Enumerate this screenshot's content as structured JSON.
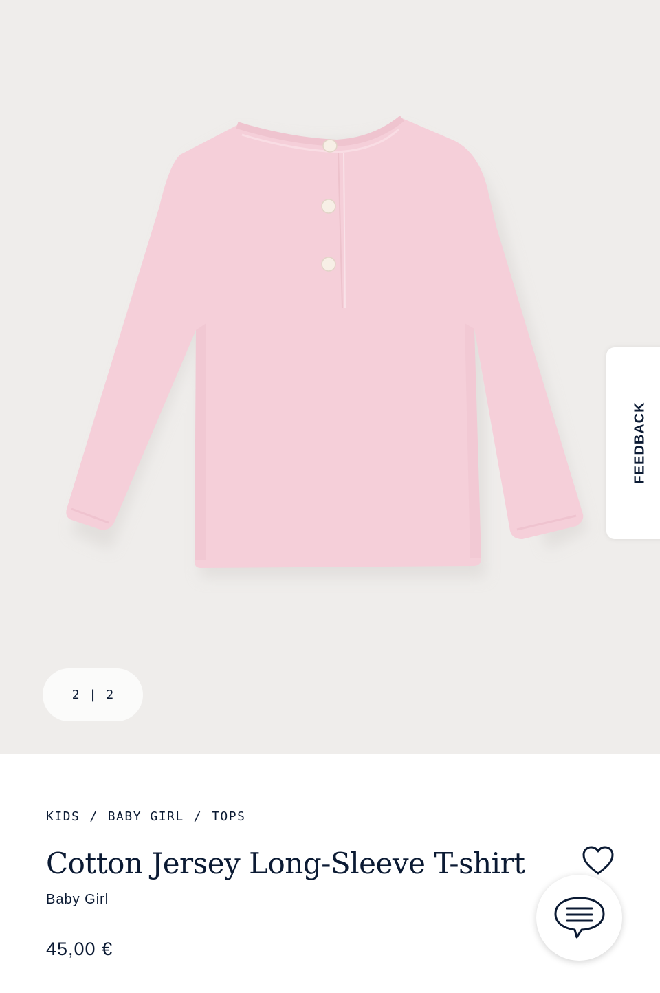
{
  "gallery": {
    "current": "2",
    "total": "2",
    "separator": "|",
    "image_icon": "long-sleeve-tshirt-back"
  },
  "feedback": {
    "label": "FEEDBACK"
  },
  "breadcrumb": {
    "items": [
      "KIDS",
      "BABY GIRL",
      "TOPS"
    ],
    "separator": "/"
  },
  "product": {
    "title": "Cotton Jersey Long-Sleeve T-shirt",
    "subtitle": "Baby Girl",
    "price": "45,00 €",
    "color": "#f5cfd9"
  },
  "icons": {
    "wishlist": "heart-icon",
    "chat": "chat-bubble-icon"
  },
  "colors": {
    "navy": "#0b1a33",
    "hero_bg": "#efedeb"
  }
}
